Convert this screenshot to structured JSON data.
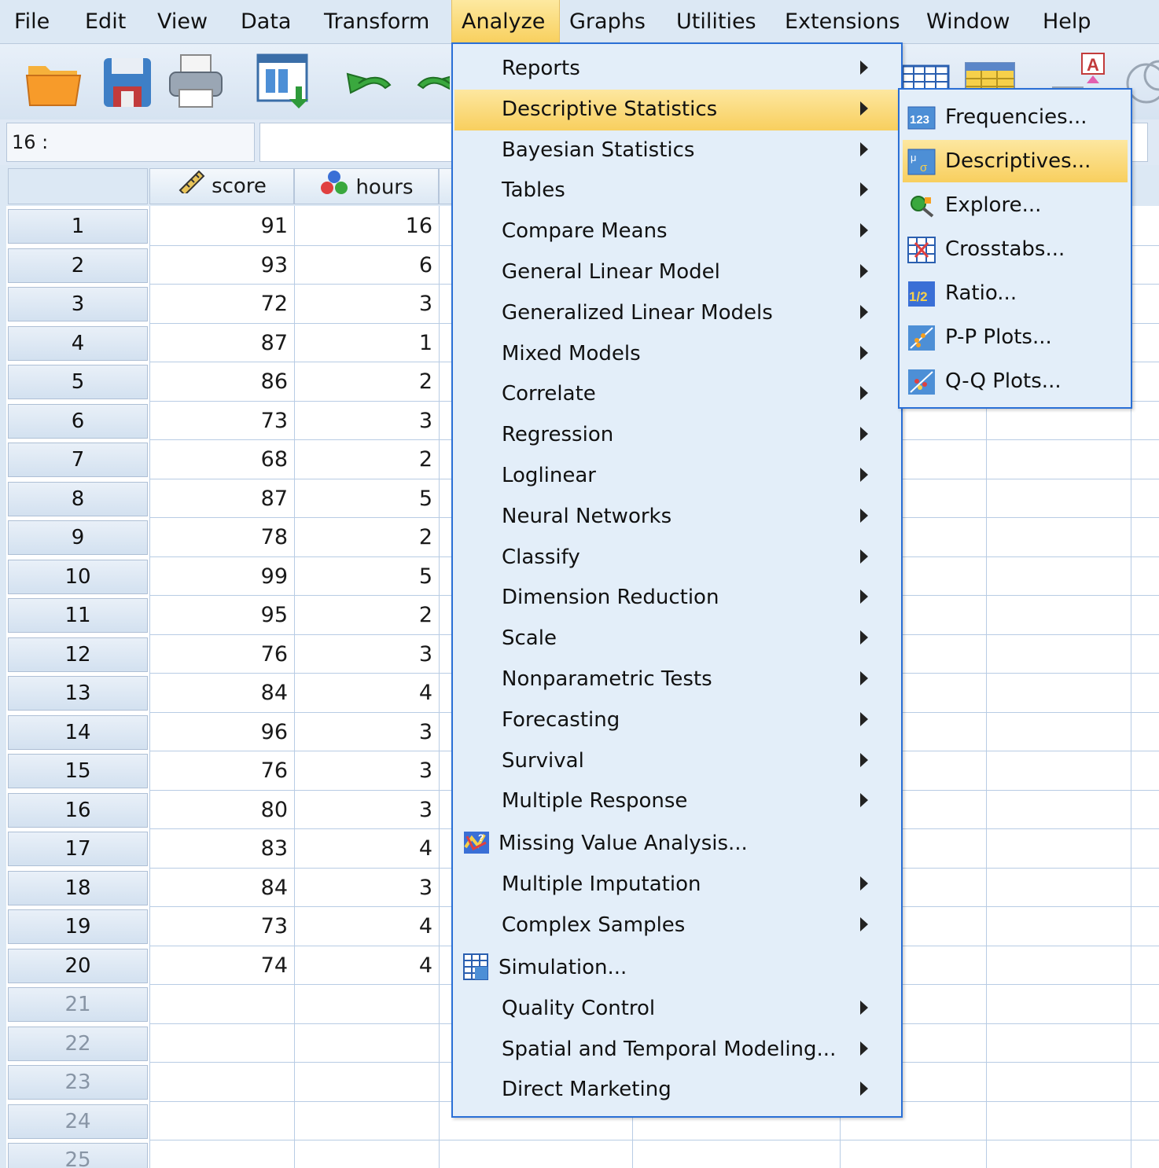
{
  "menubar": {
    "items": [
      "File",
      "Edit",
      "View",
      "Data",
      "Transform",
      "Analyze",
      "Graphs",
      "Utilities",
      "Extensions",
      "Window",
      "Help"
    ],
    "active": "Analyze"
  },
  "toolbar": {
    "icons": [
      "open-folder-icon",
      "save-icon",
      "print-icon",
      "recall-dialog-icon",
      "undo-icon",
      "redo-icon",
      "variables-icon",
      "insert-cases-icon",
      "value-labels-icon",
      "use-sets-icon"
    ]
  },
  "editor": {
    "cell_ref": "16 :",
    "cell_value": ""
  },
  "grid": {
    "columns": [
      "score",
      "hours"
    ],
    "column_icons": [
      "scale-ruler-icon",
      "nominal-balls-icon"
    ],
    "rows": [
      {
        "n": "1",
        "score": "91",
        "hours": "16"
      },
      {
        "n": "2",
        "score": "93",
        "hours": "6"
      },
      {
        "n": "3",
        "score": "72",
        "hours": "3"
      },
      {
        "n": "4",
        "score": "87",
        "hours": "1"
      },
      {
        "n": "5",
        "score": "86",
        "hours": "2"
      },
      {
        "n": "6",
        "score": "73",
        "hours": "3"
      },
      {
        "n": "7",
        "score": "68",
        "hours": "2"
      },
      {
        "n": "8",
        "score": "87",
        "hours": "5"
      },
      {
        "n": "9",
        "score": "78",
        "hours": "2"
      },
      {
        "n": "10",
        "score": "99",
        "hours": "5"
      },
      {
        "n": "11",
        "score": "95",
        "hours": "2"
      },
      {
        "n": "12",
        "score": "76",
        "hours": "3"
      },
      {
        "n": "13",
        "score": "84",
        "hours": "4"
      },
      {
        "n": "14",
        "score": "96",
        "hours": "3"
      },
      {
        "n": "15",
        "score": "76",
        "hours": "3"
      },
      {
        "n": "16",
        "score": "80",
        "hours": "3"
      },
      {
        "n": "17",
        "score": "83",
        "hours": "4"
      },
      {
        "n": "18",
        "score": "84",
        "hours": "3"
      },
      {
        "n": "19",
        "score": "73",
        "hours": "4"
      },
      {
        "n": "20",
        "score": "74",
        "hours": "4"
      }
    ],
    "empty_rows": [
      "21",
      "22",
      "23",
      "24",
      "25"
    ]
  },
  "analyze_menu": {
    "items": [
      {
        "label": "Reports",
        "submenu": true
      },
      {
        "label": "Descriptive Statistics",
        "submenu": true,
        "highlighted": true
      },
      {
        "label": "Bayesian Statistics",
        "submenu": true
      },
      {
        "label": "Tables",
        "submenu": true
      },
      {
        "label": "Compare Means",
        "submenu": true
      },
      {
        "label": "General Linear Model",
        "submenu": true
      },
      {
        "label": "Generalized Linear Models",
        "submenu": true
      },
      {
        "label": "Mixed Models",
        "submenu": true
      },
      {
        "label": "Correlate",
        "submenu": true
      },
      {
        "label": "Regression",
        "submenu": true
      },
      {
        "label": "Loglinear",
        "submenu": true
      },
      {
        "label": "Neural Networks",
        "submenu": true
      },
      {
        "label": "Classify",
        "submenu": true
      },
      {
        "label": "Dimension Reduction",
        "submenu": true
      },
      {
        "label": "Scale",
        "submenu": true
      },
      {
        "label": "Nonparametric Tests",
        "submenu": true
      },
      {
        "label": "Forecasting",
        "submenu": true
      },
      {
        "label": "Survival",
        "submenu": true
      },
      {
        "label": "Multiple Response",
        "submenu": true
      },
      {
        "label": "Missing Value Analysis...",
        "submenu": false,
        "icon": "missing-value-icon"
      },
      {
        "label": "Multiple Imputation",
        "submenu": true
      },
      {
        "label": "Complex Samples",
        "submenu": true
      },
      {
        "label": "Simulation...",
        "submenu": false,
        "icon": "simulation-icon"
      },
      {
        "label": "Quality Control",
        "submenu": true
      },
      {
        "label": "Spatial and Temporal Modeling...",
        "submenu": true
      },
      {
        "label": "Direct Marketing",
        "submenu": true
      }
    ]
  },
  "descriptive_submenu": {
    "items": [
      {
        "label": "Frequencies...",
        "icon": "frequencies-icon"
      },
      {
        "label": "Descriptives...",
        "icon": "descriptives-icon",
        "highlighted": true
      },
      {
        "label": "Explore...",
        "icon": "explore-icon"
      },
      {
        "label": "Crosstabs...",
        "icon": "crosstabs-icon"
      },
      {
        "label": "Ratio...",
        "icon": "ratio-icon"
      },
      {
        "label": "P-P Plots...",
        "icon": "pp-plots-icon"
      },
      {
        "label": "Q-Q Plots...",
        "icon": "qq-plots-icon"
      }
    ]
  },
  "colors": {
    "highlight": "#f8cf5e",
    "menu_bg": "#e3eef9",
    "menu_border": "#2a6fd6",
    "grid_line": "#b8cce4"
  }
}
